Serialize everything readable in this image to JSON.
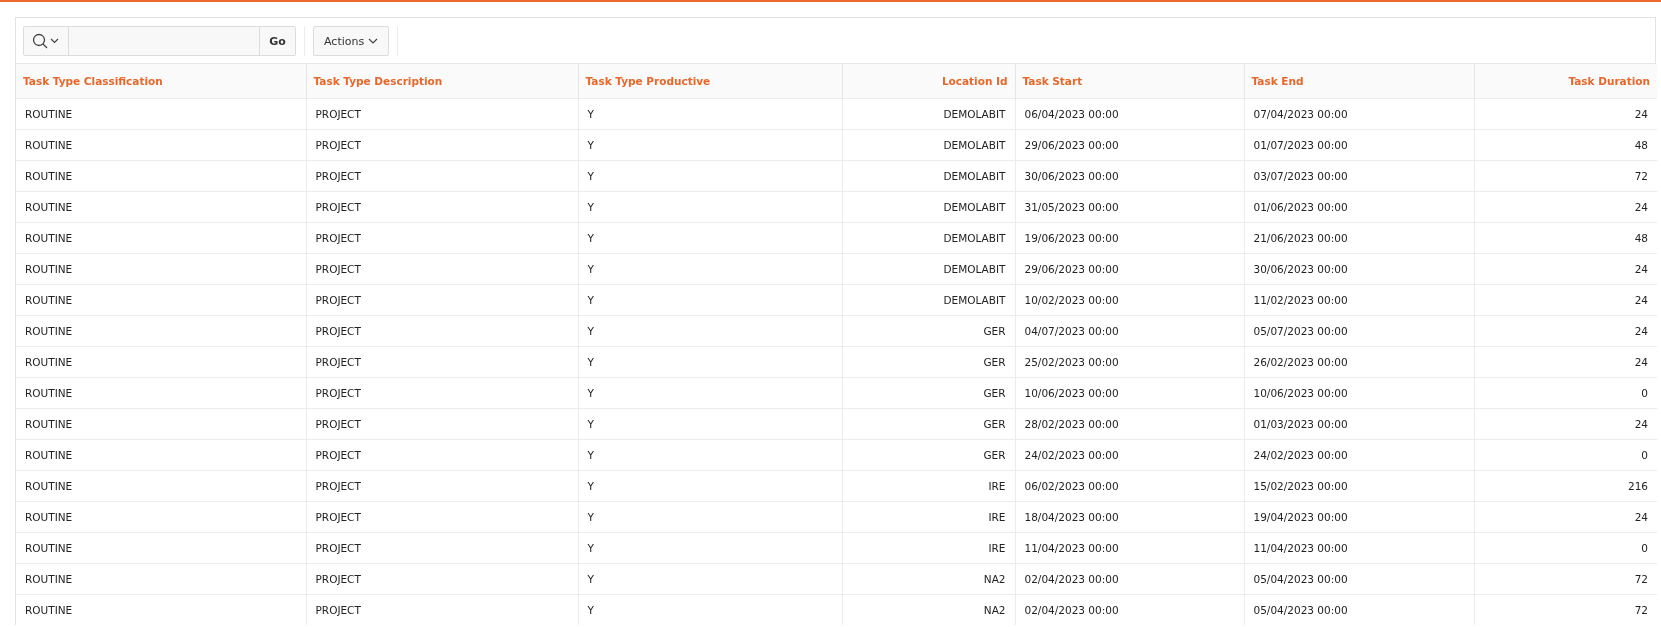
{
  "toolbar": {
    "go_button": "Go",
    "actions_button": "Actions"
  },
  "table": {
    "columns": [
      {
        "label": "Task Type Classification",
        "kind": "text"
      },
      {
        "label": "Task Type Description",
        "kind": "text"
      },
      {
        "label": "Task Type Productive",
        "kind": "text"
      },
      {
        "label": "Location Id",
        "kind": "number"
      },
      {
        "label": "Task Start",
        "kind": "text"
      },
      {
        "label": "Task End",
        "kind": "text"
      },
      {
        "label": "Task Duration",
        "kind": "number"
      }
    ],
    "rows": [
      {
        "selected": false,
        "cells": [
          "ROUTINE",
          "PROJECT",
          "Y",
          "DEMOLABIT",
          "06/04/2023 00:00",
          "07/04/2023 00:00",
          "24"
        ]
      },
      {
        "selected": false,
        "cells": [
          "ROUTINE",
          "PROJECT",
          "Y",
          "DEMOLABIT",
          "29/06/2023 00:00",
          "01/07/2023 00:00",
          "48"
        ]
      },
      {
        "selected": false,
        "cells": [
          "ROUTINE",
          "PROJECT",
          "Y",
          "DEMOLABIT",
          "30/06/2023 00:00",
          "03/07/2023 00:00",
          "72"
        ]
      },
      {
        "selected": false,
        "cells": [
          "ROUTINE",
          "PROJECT",
          "Y",
          "DEMOLABIT",
          "31/05/2023 00:00",
          "01/06/2023 00:00",
          "24"
        ]
      },
      {
        "selected": false,
        "cells": [
          "ROUTINE",
          "PROJECT",
          "Y",
          "DEMOLABIT",
          "19/06/2023 00:00",
          "21/06/2023 00:00",
          "48"
        ]
      },
      {
        "selected": false,
        "cells": [
          "ROUTINE",
          "PROJECT",
          "Y",
          "DEMOLABIT",
          "29/06/2023 00:00",
          "30/06/2023 00:00",
          "24"
        ]
      },
      {
        "selected": false,
        "cells": [
          "ROUTINE",
          "PROJECT",
          "Y",
          "DEMOLABIT",
          "10/02/2023 00:00",
          "11/02/2023 00:00",
          "24"
        ]
      },
      {
        "selected": false,
        "cells": [
          "ROUTINE",
          "PROJECT",
          "Y",
          "GER",
          "04/07/2023 00:00",
          "05/07/2023 00:00",
          "24"
        ]
      },
      {
        "selected": false,
        "cells": [
          "ROUTINE",
          "PROJECT",
          "Y",
          "GER",
          "25/02/2023 00:00",
          "26/02/2023 00:00",
          "24"
        ]
      },
      {
        "selected": false,
        "cells": [
          "ROUTINE",
          "PROJECT",
          "Y",
          "GER",
          "10/06/2023 00:00",
          "10/06/2023 00:00",
          "0"
        ]
      },
      {
        "selected": false,
        "cells": [
          "ROUTINE",
          "PROJECT",
          "Y",
          "GER",
          "28/02/2023 00:00",
          "01/03/2023 00:00",
          "24"
        ]
      },
      {
        "selected": false,
        "cells": [
          "ROUTINE",
          "PROJECT",
          "Y",
          "GER",
          "24/02/2023 00:00",
          "24/02/2023 00:00",
          "0"
        ]
      },
      {
        "selected": false,
        "cells": [
          "ROUTINE",
          "PROJECT",
          "Y",
          "IRE",
          "06/02/2023 00:00",
          "15/02/2023 00:00",
          "216"
        ]
      },
      {
        "selected": false,
        "cells": [
          "ROUTINE",
          "PROJECT",
          "Y",
          "IRE",
          "18/04/2023 00:00",
          "19/04/2023 00:00",
          "24"
        ]
      },
      {
        "selected": false,
        "cells": [
          "ROUTINE",
          "PROJECT",
          "Y",
          "IRE",
          "11/04/2023 00:00",
          "11/04/2023 00:00",
          "0"
        ]
      },
      {
        "selected": false,
        "cells": [
          "ROUTINE",
          "PROJECT",
          "Y",
          "NA2",
          "02/04/2023 00:00",
          "05/04/2023 00:00",
          "72"
        ]
      },
      {
        "selected": false,
        "cells": [
          "ROUTINE",
          "PROJECT",
          "Y",
          "NA2",
          "02/04/2023 00:00",
          "05/04/2023 00:00",
          "72"
        ]
      }
    ]
  }
}
